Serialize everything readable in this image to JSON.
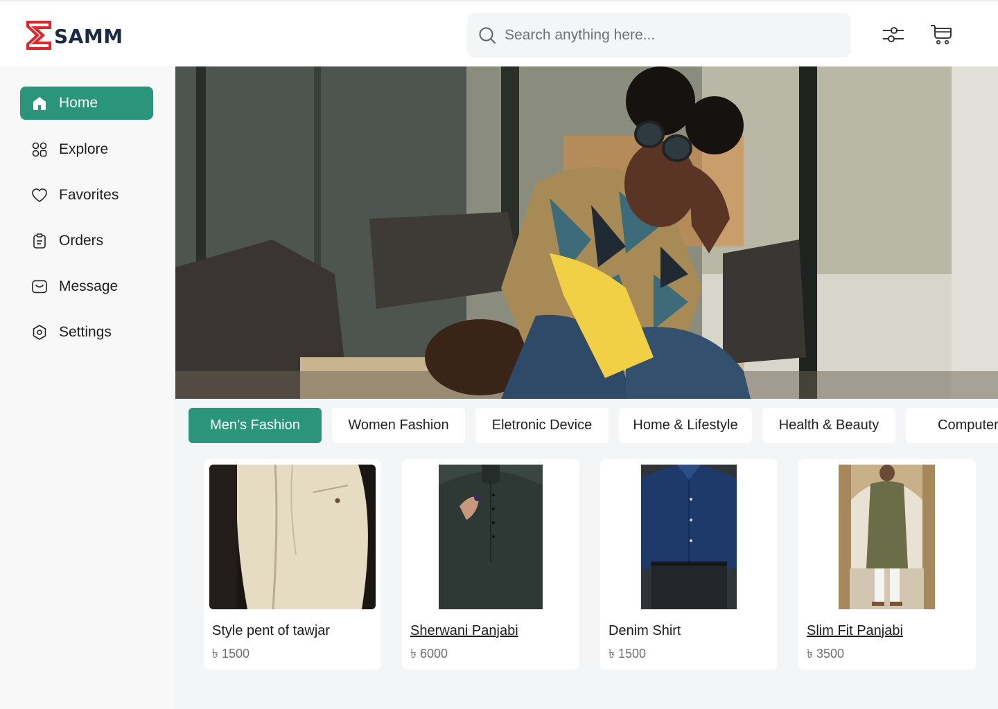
{
  "brand": {
    "name": "SAMM",
    "accent": "#2a957a",
    "logo_color": "#e0262a"
  },
  "search": {
    "placeholder": "Search anything here..."
  },
  "header_icons": {
    "filter": "sliders-icon",
    "cart": "cart-icon"
  },
  "sidebar": {
    "items": [
      {
        "label": "Home",
        "icon": "home-icon",
        "active": true
      },
      {
        "label": "Explore",
        "icon": "grid-icon",
        "active": false
      },
      {
        "label": "Favorites",
        "icon": "heart-icon",
        "active": false
      },
      {
        "label": "Orders",
        "icon": "clipboard-icon",
        "active": false
      },
      {
        "label": "Message",
        "icon": "inbox-icon",
        "active": false
      },
      {
        "label": "Settings",
        "icon": "hexagon-settings-icon",
        "active": false
      }
    ]
  },
  "categories": [
    {
      "label": "Men’s Fashion",
      "active": true
    },
    {
      "label": "Women Fashion",
      "active": false
    },
    {
      "label": "Eletronic Device",
      "active": false
    },
    {
      "label": "Home & Lifestyle",
      "active": false
    },
    {
      "label": "Health & Beauty",
      "active": false
    },
    {
      "label": "Computer",
      "active": false
    }
  ],
  "products": [
    {
      "name": "Style pent of tawjar",
      "price": "৳ 1500"
    },
    {
      "name": "Sherwani Panjabi",
      "price": "৳ 6000"
    },
    {
      "name": "Denim Shirt",
      "price": "৳ 1500"
    },
    {
      "name": "Slim Fit Panjabi",
      "price": "৳ 3500"
    }
  ]
}
